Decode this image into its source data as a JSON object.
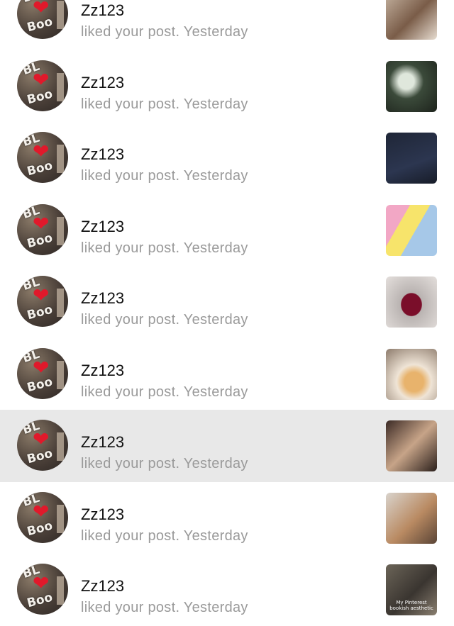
{
  "notifications": [
    {
      "username": "Zz123",
      "activity": "liked your post. Yesterday",
      "avatar_text_top": "BL",
      "avatar_text_bottom": "Boo",
      "thumb_caption": "",
      "highlighted": false
    },
    {
      "username": "Zz123",
      "activity": "liked your post. Yesterday",
      "avatar_text_top": "BL",
      "avatar_text_bottom": "Boo",
      "thumb_caption": "",
      "highlighted": false
    },
    {
      "username": "Zz123",
      "activity": "liked your post. Yesterday",
      "avatar_text_top": "BL",
      "avatar_text_bottom": "Boo",
      "thumb_caption": "",
      "highlighted": false
    },
    {
      "username": "Zz123",
      "activity": "liked your post. Yesterday",
      "avatar_text_top": "BL",
      "avatar_text_bottom": "Boo",
      "thumb_caption": "",
      "highlighted": false
    },
    {
      "username": "Zz123",
      "activity": "liked your post. Yesterday",
      "avatar_text_top": "BL",
      "avatar_text_bottom": "Boo",
      "thumb_caption": "",
      "highlighted": false
    },
    {
      "username": "Zz123",
      "activity": "liked your post. Yesterday",
      "avatar_text_top": "BL",
      "avatar_text_bottom": "Boo",
      "thumb_caption": "",
      "highlighted": false
    },
    {
      "username": "Zz123",
      "activity": "liked your post. Yesterday",
      "avatar_text_top": "BL",
      "avatar_text_bottom": "Boo",
      "thumb_caption": "",
      "highlighted": true
    },
    {
      "username": "Zz123",
      "activity": "liked your post. Yesterday",
      "avatar_text_top": "BL",
      "avatar_text_bottom": "Boo",
      "thumb_caption": "",
      "highlighted": false
    },
    {
      "username": "Zz123",
      "activity": "liked your post. Yesterday",
      "avatar_text_top": "BL",
      "avatar_text_bottom": "Boo",
      "thumb_caption": "My Pinterest bookish aesthetic",
      "highlighted": false
    }
  ],
  "colors": {
    "highlight_bg": "#e8e8e8",
    "username": "#111111",
    "activity": "#9a9a9a",
    "heart": "#e0192b"
  }
}
